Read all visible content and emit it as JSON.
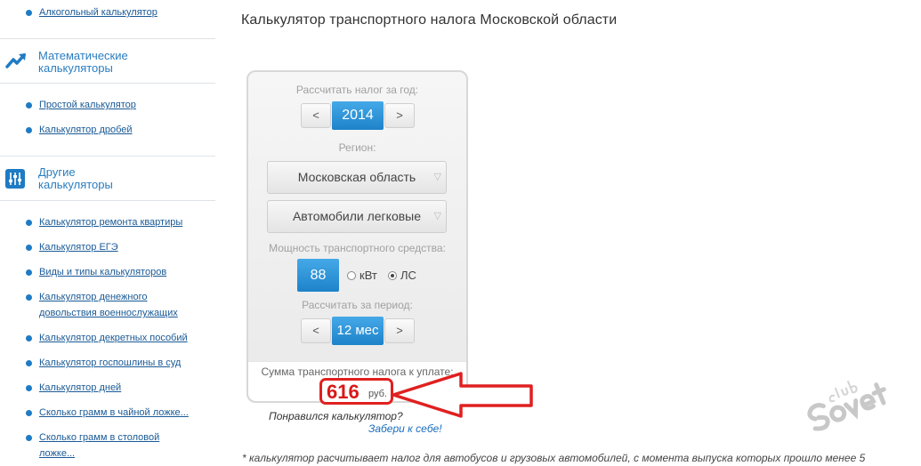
{
  "sidebar": {
    "top_item": "Алкогольный калькулятор",
    "section_math": {
      "title_line1": "Математические",
      "title_line2": "калькуляторы",
      "icon": "trend-chart-icon",
      "items": [
        "Простой калькулятор",
        "Калькулятор дробей"
      ]
    },
    "section_other": {
      "title_line1": "Другие",
      "title_line2": "калькуляторы",
      "icon": "sliders-icon",
      "items": [
        "Калькулятор ремонта квартиры",
        "Калькулятор ЕГЭ",
        "Виды и типы калькуляторов",
        "Калькулятор денежного",
        "довольствия военнослужащих",
        "Калькулятор декретных пособий",
        "Калькулятор госпошлины в суд",
        "Калькулятор дней",
        "Сколько грамм в чайной ложке...",
        "Сколько грамм в столовой",
        "ложке..."
      ]
    }
  },
  "page": {
    "title": "Калькулятор транспортного налога Московской области"
  },
  "calculator": {
    "year_label": "Рассчитать налог за год:",
    "year_value": "2014",
    "prev": "<",
    "next": ">",
    "region_label": "Регион:",
    "region_value": "Московская область",
    "vehicle_value": "Автомобили легковые",
    "select_arrow": "▽",
    "power_label": "Мощность транспортного средства:",
    "power_value": "88",
    "unit_kw": "кВт",
    "unit_hp": "ЛС",
    "selected_unit": "ЛС",
    "period_label": "Рассчитать за период:",
    "period_value": "12 мес",
    "sum_label": "Сумма транспортного налога к уплате:",
    "result_value": "616",
    "result_unit": "руб."
  },
  "footer": {
    "liked": "Понравился калькулятор?",
    "share": "Забери к себе!",
    "footnote": "* калькулятор расчитывает налог для автобусов и грузовых автомобилей, с момента выпуска которых прошло менее 5"
  },
  "colors": {
    "accent_blue": "#1e7bc4",
    "highlight_red": "#e02020"
  }
}
